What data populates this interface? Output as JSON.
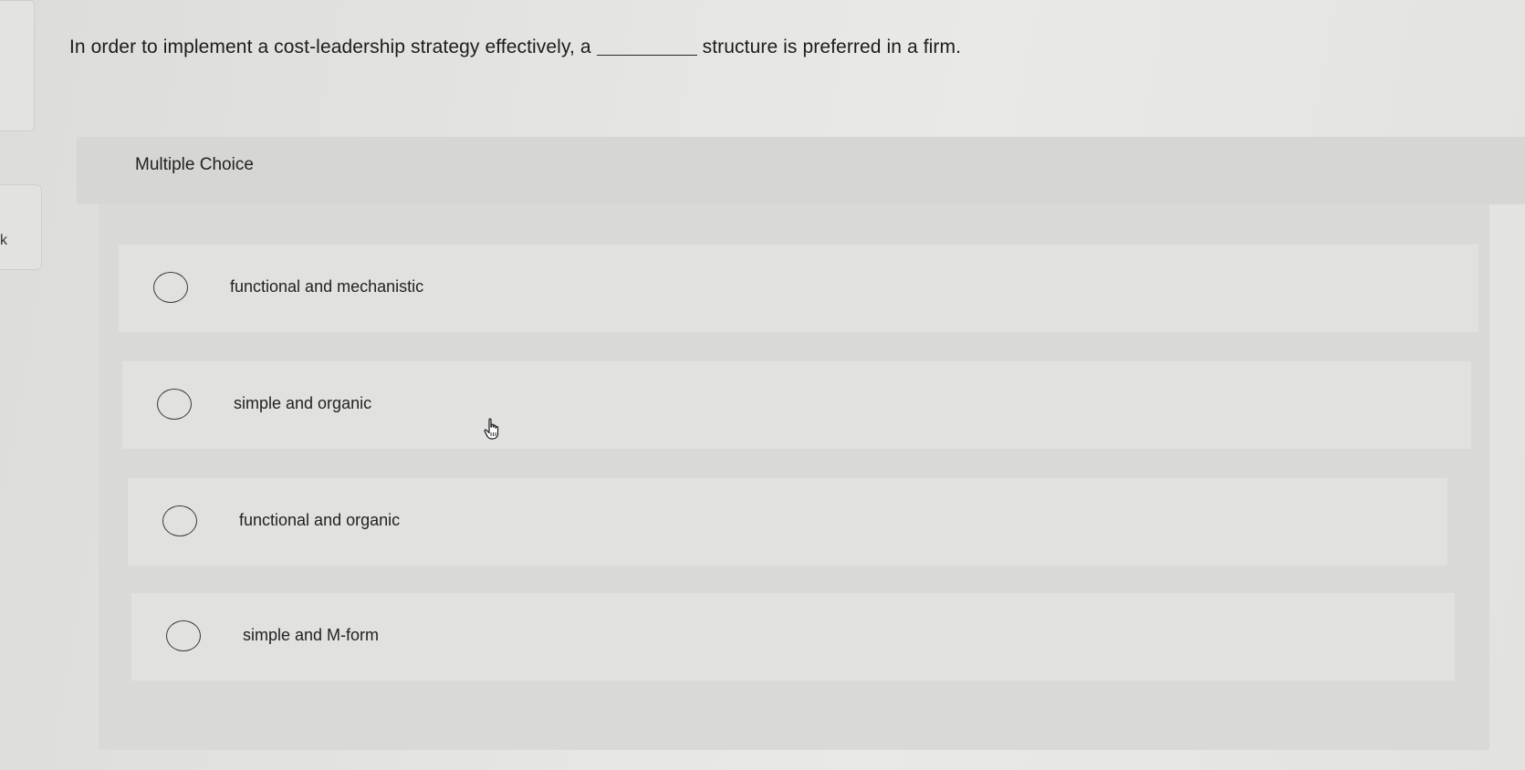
{
  "question": {
    "text_before": "In order to implement a cost-leadership strategy effectively, a",
    "text_after": "structure is preferred in a firm."
  },
  "section": {
    "label": "Multiple Choice"
  },
  "choices": [
    {
      "label": "functional and mechanistic",
      "selected": false
    },
    {
      "label": "simple and organic",
      "selected": false
    },
    {
      "label": "functional and organic",
      "selected": false
    },
    {
      "label": "simple and M-form",
      "selected": false
    }
  ],
  "side": {
    "glyph": "k"
  },
  "cursor": {
    "icon": "hand-pointer-icon"
  }
}
